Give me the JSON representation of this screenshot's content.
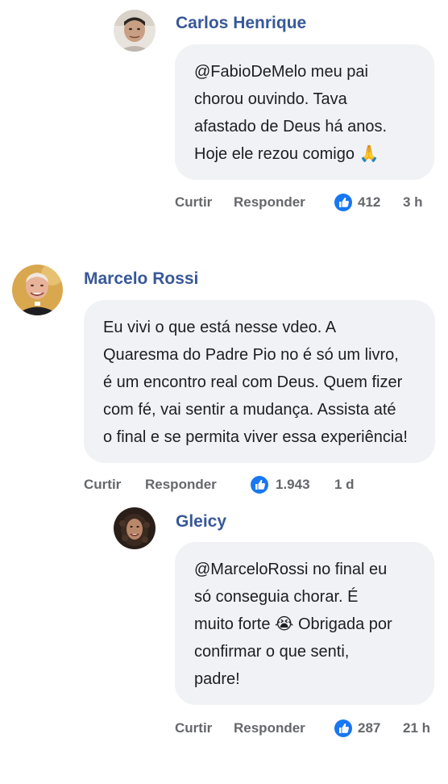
{
  "comments": [
    {
      "author": "Carlos Henrique",
      "text_lines": [
        "@FabioDeMelo meu pai",
        "chorou ouvindo. Tava",
        "afastado de Deus há anos.",
        "Hoje ele rezou comigo 🙏"
      ],
      "like_label": "Curtir",
      "reply_label": "Responder",
      "reaction_icon": "like-icon",
      "reaction_count": "412",
      "time": "3 h"
    },
    {
      "author": "Marcelo Rossi",
      "text_lines": [
        "Eu vivi o que está nesse vdeo. A",
        "Quaresma do Padre Pio no é só um livro,",
        "é um encontro real com Deus. Quem fizer",
        "com fé, vai sentir a mudança. Assista até",
        "o final e se permita viver essa experiência!"
      ],
      "like_label": "Curtir",
      "reply_label": "Responder",
      "reaction_icon": "like-icon",
      "reaction_count": "1.943",
      "time": "1 d"
    },
    {
      "author": "Gleicy",
      "text_lines": [
        "@MarceloRossi no final eu",
        "só conseguia chorar. É",
        "muito forte 😭 Obrigada por",
        "confirmar o que senti,",
        "padre!"
      ],
      "like_label": "Curtir",
      "reply_label": "Responder",
      "reaction_icon": "like-icon",
      "reaction_count": "287",
      "time": "21 h"
    }
  ],
  "colors": {
    "author_name": "#385898",
    "bubble_bg": "#f0f2f5",
    "meta_text": "#65676b",
    "like_blue": "#1877f2"
  }
}
